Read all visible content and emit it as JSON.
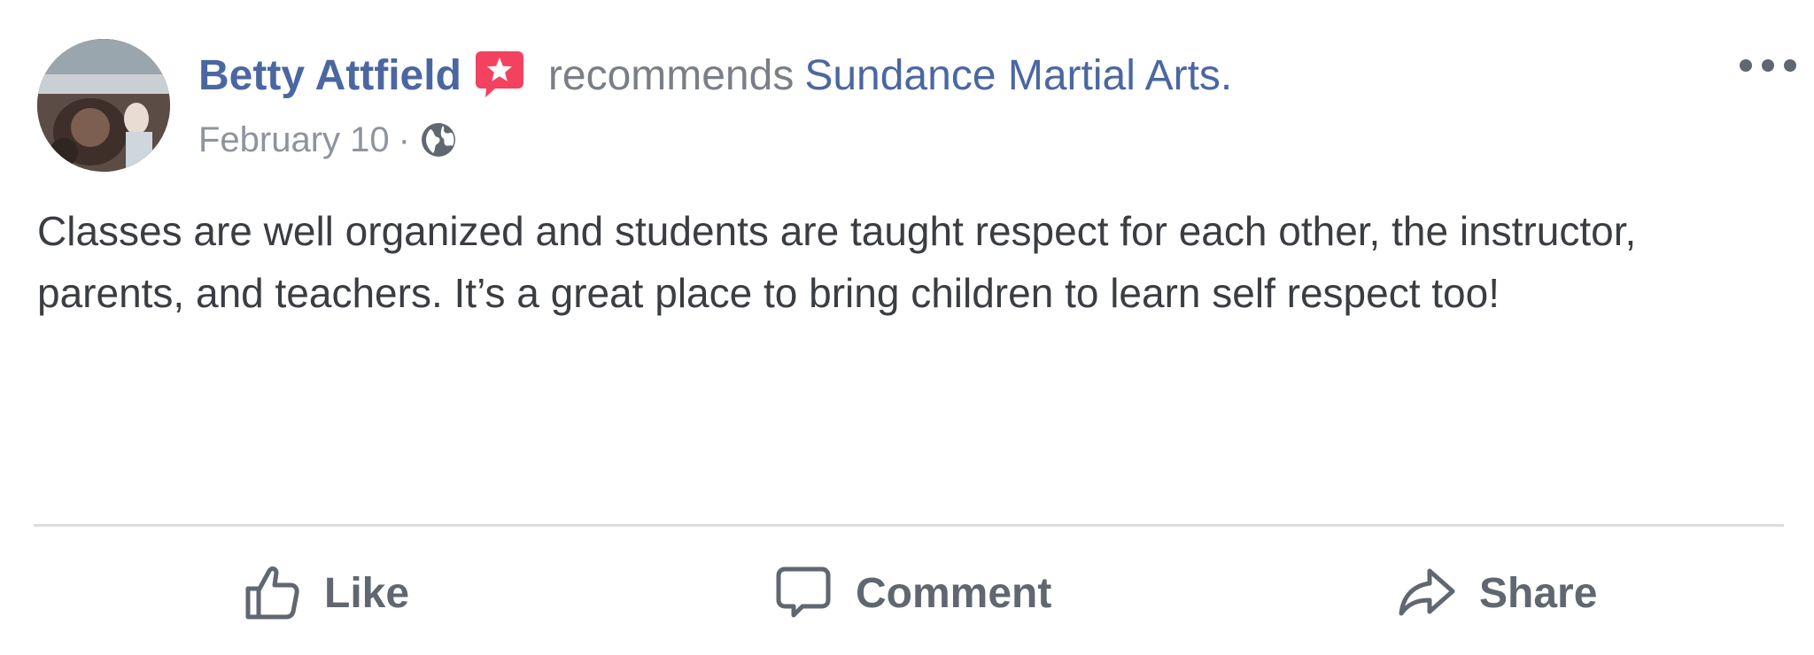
{
  "post": {
    "author": "Betty Attfield",
    "action_text": "recommends",
    "page_name": "Sundance Martial Arts.",
    "date": "February 10",
    "separator": "·",
    "body": "Classes are well organized and students are taught respect for each other, the instructor, parents, and teachers. It’s a great place to bring children to learn self respect too!"
  },
  "icons": {
    "recommend": "recommendation-star-badge-icon",
    "privacy": "globe-icon",
    "more": "more-options-icon",
    "like": "thumbs-up-icon",
    "comment": "comment-bubble-icon",
    "share": "share-arrow-icon"
  },
  "actions": {
    "like_label": "Like",
    "comment_label": "Comment",
    "share_label": "Share"
  },
  "colors": {
    "link_blue": "#4b67a1",
    "badge_red": "#f3425f",
    "muted_text": "#8d949e",
    "action_gray": "#606770",
    "divider": "#dadde1"
  }
}
